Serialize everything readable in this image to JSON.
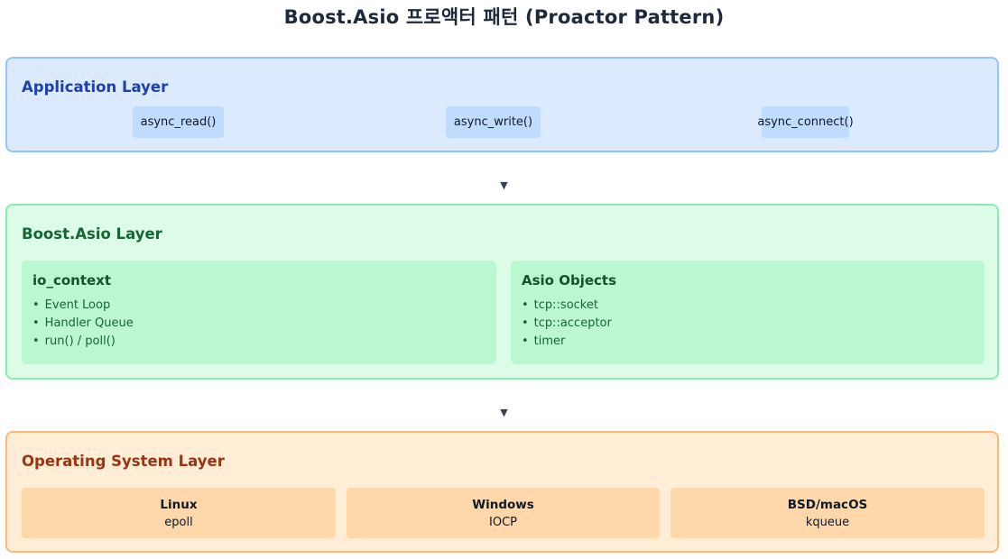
{
  "title": "Boost.Asio 프로액터 패턴 (Proactor Pattern)",
  "arrow_glyph": "▼",
  "application_layer": {
    "title": "Application Layer",
    "functions": [
      "async_read()",
      "async_write()",
      "async_connect()"
    ]
  },
  "asio_layer": {
    "title": "Boost.Asio Layer",
    "panels": [
      {
        "title": "io_context",
        "items": [
          "Event Loop",
          "Handler Queue",
          "run() / poll()"
        ]
      },
      {
        "title": "Asio Objects",
        "items": [
          "tcp::socket",
          "tcp::acceptor",
          "timer"
        ]
      }
    ]
  },
  "os_layer": {
    "title": "Operating System Layer",
    "systems": [
      {
        "name": "Linux",
        "mechanism": "epoll"
      },
      {
        "name": "Windows",
        "mechanism": "IOCP"
      },
      {
        "name": "BSD/macOS",
        "mechanism": "kqueue"
      }
    ]
  },
  "colors": {
    "app_bg": "#dbeafe",
    "app_border": "#93c5fd",
    "app_title": "#1e40af",
    "asio_bg": "#dcfce7",
    "asio_border": "#86efac",
    "asio_title": "#166534",
    "os_bg": "#ffedd5",
    "os_border": "#fdba74",
    "os_title": "#9a3412"
  }
}
